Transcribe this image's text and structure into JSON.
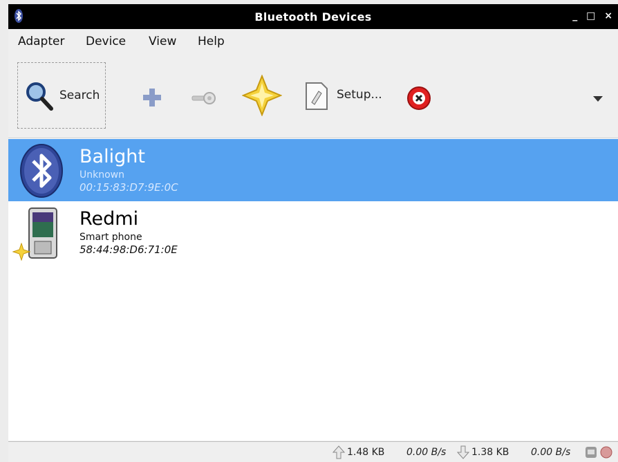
{
  "window": {
    "title": "Bluetooth Devices",
    "controls": [
      "_",
      "□",
      "×"
    ]
  },
  "menu": [
    "Adapter",
    "Device",
    "View",
    "Help"
  ],
  "toolbar": {
    "search_label": "Search",
    "setup_label": "Setup...",
    "icons": [
      "search-icon",
      "add-device-icon",
      "pair-key-icon",
      "trust-star-icon",
      "setup-icon",
      "remove-icon",
      "dropdown-arrow-icon"
    ]
  },
  "devices": [
    {
      "name": "Balight",
      "type": "Unknown",
      "address": "00:15:83:D7:9E:0C",
      "selected": true,
      "icon": "bluetooth-icon"
    },
    {
      "name": "Redmi",
      "type": "Smart phone",
      "address": "58:44:98:D6:71:0E",
      "selected": false,
      "trusted": true,
      "icon": "phone-icon"
    }
  ],
  "status": {
    "upload_total": "1.48 KB",
    "upload_rate": "0.00 B/s",
    "download_total": "1.38 KB",
    "download_rate": "0.00 B/s"
  },
  "colors": {
    "selection": "#56a2f0",
    "titlebar": "#000000"
  }
}
